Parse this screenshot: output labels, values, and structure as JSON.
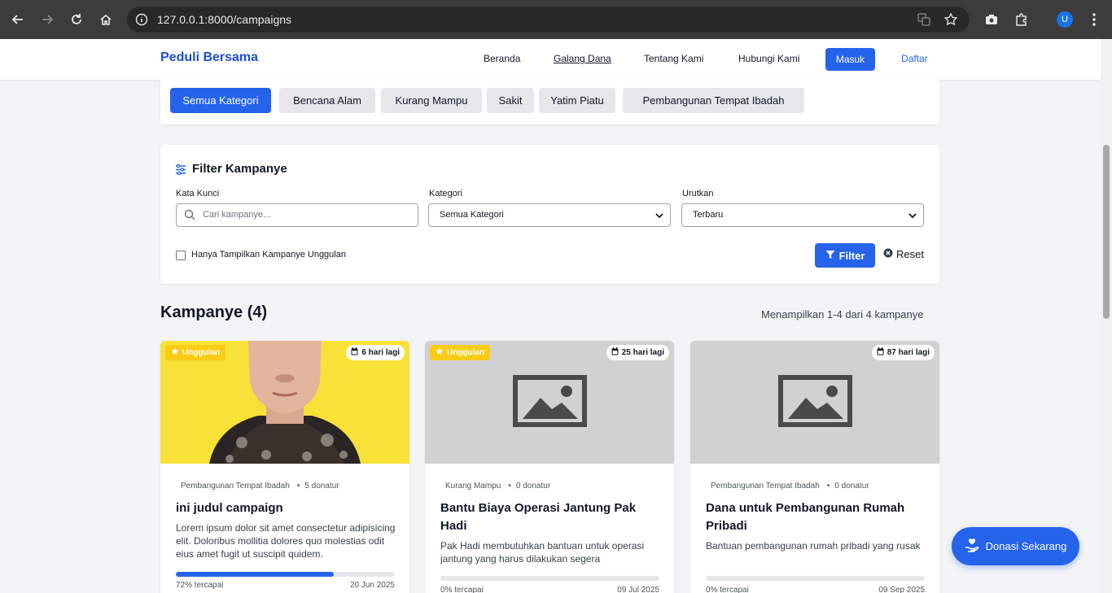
{
  "browser": {
    "url": "127.0.0.1:8000/campaigns",
    "profile_initial": "U"
  },
  "navbar": {
    "brand": "Peduli Bersama",
    "links": [
      "Beranda",
      "Galang Dana",
      "Tentang Kami",
      "Hubungi Kami"
    ],
    "login_label": "Masuk",
    "register_label": "Daftar"
  },
  "categories": [
    "Semua Kategori",
    "Bencana Alam",
    "Kurang Mampu",
    "Sakit",
    "Yatim Piatu",
    "Pembangunan Tempat Ibadah"
  ],
  "filter": {
    "title": "Filter Kampanye",
    "keyword_label": "Kata Kunci",
    "keyword_placeholder": "Cari kampanye...",
    "category_label": "Kategori",
    "category_value": "Semua Kategori",
    "sort_label": "Urutkan",
    "sort_value": "Terbaru",
    "featured_only_label": "Hanya Tampilkan Kampanye Unggulan",
    "filter_button": "Filter",
    "reset_button": "Reset"
  },
  "section": {
    "title": "Kampanye (4)",
    "count_text": "Menampilkan 1-4 dari 4 kampanye"
  },
  "campaigns": [
    {
      "featured_label": "Unggulan",
      "days_left": "6 hari lagi",
      "category": "Pembangunan Tempat Ibadah",
      "donors": "5 donatur",
      "title": "ini judul campaign",
      "description": "Lorem ipsum dolor sit amet consectetur adipisicing elit. Doloribus mollitia dolores quo molestias odit eius amet fugit ut suscipit quidem.",
      "progress_percent": 72,
      "progress_label": "72% tercapai",
      "end_date": "20 Jun 2025"
    },
    {
      "featured_label": "Unggulan",
      "days_left": "25 hari lagi",
      "category": "Kurang Mampu",
      "donors": "0 donatur",
      "title": "Bantu Biaya Operasi Jantung Pak Hadi",
      "description": "Pak Hadi membutuhkan bantuan untuk operasi jantung yang harus dilakukan segera",
      "progress_percent": 0,
      "progress_label": "0% tercapai",
      "end_date": "09 Jul 2025"
    },
    {
      "featured_label": "",
      "days_left": "87 hari lagi",
      "category": "Pembangunan Tempat Ibadah",
      "donors": "0 donatur",
      "title": "Dana untuk Pembangunan Rumah Pribadi",
      "description": "Bantuan pembangunan rumah pribadi yang rusak",
      "progress_percent": 0,
      "progress_label": "0% tercapai",
      "end_date": "09 Sep 2025"
    }
  ],
  "donate_fab": "Donasi Sekarang",
  "colors": {
    "primary": "#2563eb",
    "featured": "#facc15",
    "chrome": "#3c3c3c"
  }
}
